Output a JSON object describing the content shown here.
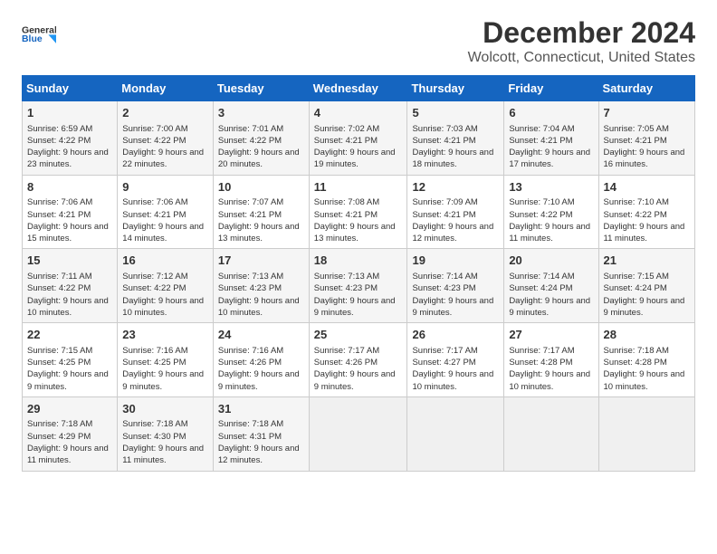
{
  "logo": {
    "line1": "General",
    "line2": "Blue"
  },
  "title": "December 2024",
  "subtitle": "Wolcott, Connecticut, United States",
  "days_header": [
    "Sunday",
    "Monday",
    "Tuesday",
    "Wednesday",
    "Thursday",
    "Friday",
    "Saturday"
  ],
  "weeks": [
    [
      {
        "day": "1",
        "sunrise": "6:59 AM",
        "sunset": "4:22 PM",
        "daylight": "9 hours and 23 minutes."
      },
      {
        "day": "2",
        "sunrise": "7:00 AM",
        "sunset": "4:22 PM",
        "daylight": "9 hours and 22 minutes."
      },
      {
        "day": "3",
        "sunrise": "7:01 AM",
        "sunset": "4:22 PM",
        "daylight": "9 hours and 20 minutes."
      },
      {
        "day": "4",
        "sunrise": "7:02 AM",
        "sunset": "4:21 PM",
        "daylight": "9 hours and 19 minutes."
      },
      {
        "day": "5",
        "sunrise": "7:03 AM",
        "sunset": "4:21 PM",
        "daylight": "9 hours and 18 minutes."
      },
      {
        "day": "6",
        "sunrise": "7:04 AM",
        "sunset": "4:21 PM",
        "daylight": "9 hours and 17 minutes."
      },
      {
        "day": "7",
        "sunrise": "7:05 AM",
        "sunset": "4:21 PM",
        "daylight": "9 hours and 16 minutes."
      }
    ],
    [
      {
        "day": "8",
        "sunrise": "7:06 AM",
        "sunset": "4:21 PM",
        "daylight": "9 hours and 15 minutes."
      },
      {
        "day": "9",
        "sunrise": "7:06 AM",
        "sunset": "4:21 PM",
        "daylight": "9 hours and 14 minutes."
      },
      {
        "day": "10",
        "sunrise": "7:07 AM",
        "sunset": "4:21 PM",
        "daylight": "9 hours and 13 minutes."
      },
      {
        "day": "11",
        "sunrise": "7:08 AM",
        "sunset": "4:21 PM",
        "daylight": "9 hours and 13 minutes."
      },
      {
        "day": "12",
        "sunrise": "7:09 AM",
        "sunset": "4:21 PM",
        "daylight": "9 hours and 12 minutes."
      },
      {
        "day": "13",
        "sunrise": "7:10 AM",
        "sunset": "4:22 PM",
        "daylight": "9 hours and 11 minutes."
      },
      {
        "day": "14",
        "sunrise": "7:10 AM",
        "sunset": "4:22 PM",
        "daylight": "9 hours and 11 minutes."
      }
    ],
    [
      {
        "day": "15",
        "sunrise": "7:11 AM",
        "sunset": "4:22 PM",
        "daylight": "9 hours and 10 minutes."
      },
      {
        "day": "16",
        "sunrise": "7:12 AM",
        "sunset": "4:22 PM",
        "daylight": "9 hours and 10 minutes."
      },
      {
        "day": "17",
        "sunrise": "7:13 AM",
        "sunset": "4:23 PM",
        "daylight": "9 hours and 10 minutes."
      },
      {
        "day": "18",
        "sunrise": "7:13 AM",
        "sunset": "4:23 PM",
        "daylight": "9 hours and 9 minutes."
      },
      {
        "day": "19",
        "sunrise": "7:14 AM",
        "sunset": "4:23 PM",
        "daylight": "9 hours and 9 minutes."
      },
      {
        "day": "20",
        "sunrise": "7:14 AM",
        "sunset": "4:24 PM",
        "daylight": "9 hours and 9 minutes."
      },
      {
        "day": "21",
        "sunrise": "7:15 AM",
        "sunset": "4:24 PM",
        "daylight": "9 hours and 9 minutes."
      }
    ],
    [
      {
        "day": "22",
        "sunrise": "7:15 AM",
        "sunset": "4:25 PM",
        "daylight": "9 hours and 9 minutes."
      },
      {
        "day": "23",
        "sunrise": "7:16 AM",
        "sunset": "4:25 PM",
        "daylight": "9 hours and 9 minutes."
      },
      {
        "day": "24",
        "sunrise": "7:16 AM",
        "sunset": "4:26 PM",
        "daylight": "9 hours and 9 minutes."
      },
      {
        "day": "25",
        "sunrise": "7:17 AM",
        "sunset": "4:26 PM",
        "daylight": "9 hours and 9 minutes."
      },
      {
        "day": "26",
        "sunrise": "7:17 AM",
        "sunset": "4:27 PM",
        "daylight": "9 hours and 10 minutes."
      },
      {
        "day": "27",
        "sunrise": "7:17 AM",
        "sunset": "4:28 PM",
        "daylight": "9 hours and 10 minutes."
      },
      {
        "day": "28",
        "sunrise": "7:18 AM",
        "sunset": "4:28 PM",
        "daylight": "9 hours and 10 minutes."
      }
    ],
    [
      {
        "day": "29",
        "sunrise": "7:18 AM",
        "sunset": "4:29 PM",
        "daylight": "9 hours and 11 minutes."
      },
      {
        "day": "30",
        "sunrise": "7:18 AM",
        "sunset": "4:30 PM",
        "daylight": "9 hours and 11 minutes."
      },
      {
        "day": "31",
        "sunrise": "7:18 AM",
        "sunset": "4:31 PM",
        "daylight": "9 hours and 12 minutes."
      },
      null,
      null,
      null,
      null
    ]
  ]
}
